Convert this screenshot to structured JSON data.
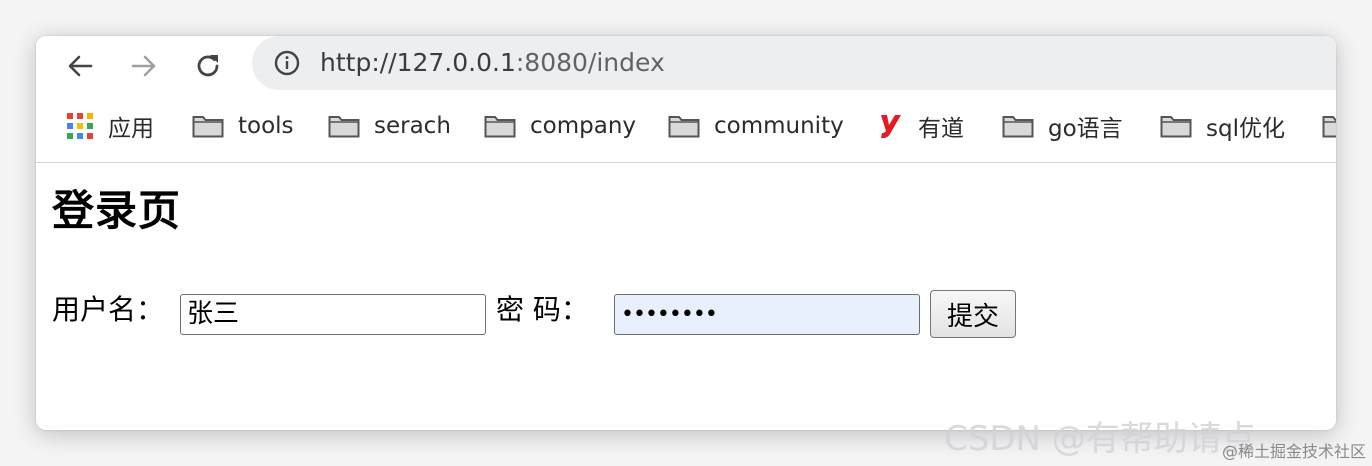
{
  "browser": {
    "url_host": "http://127.0.0.1",
    "url_rest": ":8080/index"
  },
  "bookmarks": {
    "apps": "应用",
    "items": [
      "tools",
      "serach",
      "company",
      "community",
      "有道",
      "go语言",
      "sql优化"
    ]
  },
  "page": {
    "title": "登录页",
    "username_label": "用户名：",
    "username_value": "张三",
    "password_label": "密 码：",
    "password_value": "••••••••",
    "submit_label": "提交"
  },
  "watermark": {
    "big": "CSDN @有帮助请点",
    "small": "@稀土掘金技术社区"
  },
  "colors": {
    "youdao_red": "#e31b23",
    "autofill_bg": "#e8effd"
  }
}
